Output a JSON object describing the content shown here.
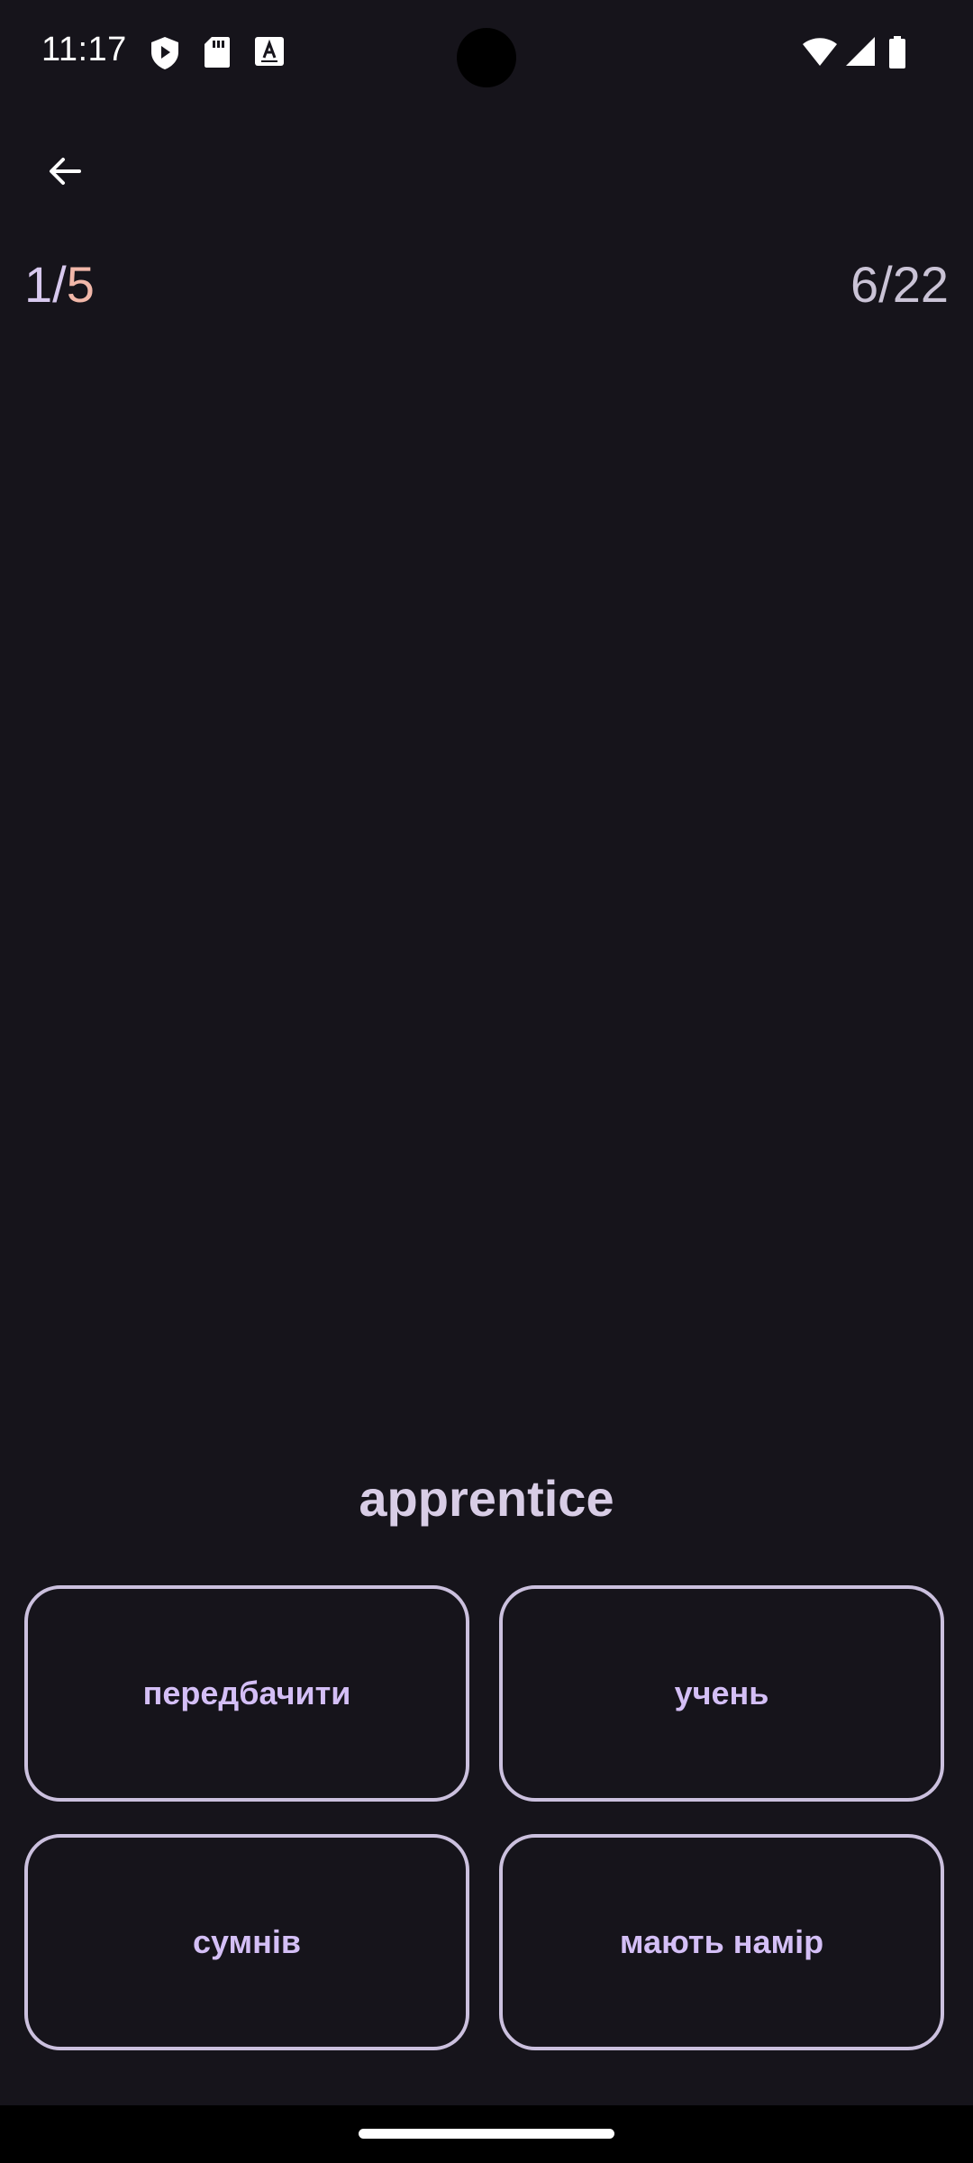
{
  "status_bar": {
    "time": "11:17",
    "icons": [
      "play-protect-icon",
      "sd-card-icon",
      "keyboard-a-icon",
      "wifi-icon",
      "signal-icon",
      "battery-icon"
    ]
  },
  "app_bar": {
    "back_icon": "arrow-back-icon"
  },
  "quiz": {
    "progress_current": "1",
    "progress_separator": "/",
    "progress_total": "5",
    "overall_counter": "6/22",
    "question_word": "apprentice",
    "answers": [
      {
        "label": "передбачити"
      },
      {
        "label": "учень"
      },
      {
        "label": "сумнів"
      },
      {
        "label": "мають намір"
      }
    ]
  },
  "colors": {
    "background": "#16141b",
    "accent_progress_total": "#f1b7a9",
    "answer_border": "#cbc0de",
    "answer_text": "#d4bff6"
  }
}
